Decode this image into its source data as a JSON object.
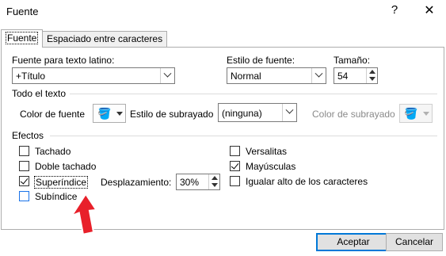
{
  "window": {
    "title": "Fuente",
    "help_icon": "question-mark-icon",
    "close_icon": "close-icon"
  },
  "tabs": [
    {
      "label": "Fuente",
      "active": true
    },
    {
      "label": "Espaciado entre caracteres",
      "active": false
    }
  ],
  "latin_font": {
    "label": "Fuente para texto latino:",
    "value": "+Título"
  },
  "font_style": {
    "label": "Estilo de fuente:",
    "value": "Normal"
  },
  "size": {
    "label": "Tamaño:",
    "value": "54"
  },
  "all_text": {
    "section_title": "Todo el texto",
    "font_color_label": "Color de fuente",
    "underline_style_label": "Estilo de subrayado",
    "underline_style_value": "(ninguna)",
    "underline_color_label": "Color de subrayado"
  },
  "effects": {
    "section_title": "Efectos",
    "left": [
      {
        "label": "Tachado",
        "checked": false
      },
      {
        "label": "Doble tachado",
        "checked": false
      },
      {
        "label": "Superíndice",
        "checked": true
      },
      {
        "label": "Subíndice",
        "checked": false
      }
    ],
    "right": [
      {
        "label": "Versalitas",
        "checked": false
      },
      {
        "label": "Mayúsculas",
        "checked": true
      },
      {
        "label": "Igualar alto de los caracteres",
        "checked": false
      }
    ],
    "offset_label": "Desplazamiento:",
    "offset_value": "30%"
  },
  "buttons": {
    "ok": "Aceptar",
    "cancel": "Cancelar"
  },
  "colors": {
    "accent": "#0078d7",
    "annotation_arrow": "#e8202a"
  }
}
